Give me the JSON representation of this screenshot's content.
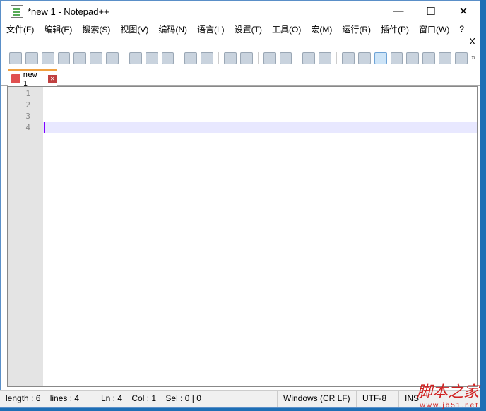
{
  "window": {
    "title": "*new 1 - Notepad++",
    "minimize": "—",
    "maximize": "☐",
    "close": "✕"
  },
  "menu": [
    "文件(F)",
    "编辑(E)",
    "搜索(S)",
    "视图(V)",
    "编码(N)",
    "语言(L)",
    "设置(T)",
    "工具(O)",
    "宏(M)",
    "运行(R)",
    "插件(P)",
    "窗口(W)",
    "?"
  ],
  "close_doc": "X",
  "toolbar_more": "»",
  "tab": {
    "label": "new 1",
    "close": "✕"
  },
  "lines": [
    "1",
    "2",
    "3",
    "4"
  ],
  "status": {
    "length": "length : 6",
    "lines": "lines : 4",
    "ln": "Ln : 4",
    "col": "Col : 1",
    "sel": "Sel : 0 | 0",
    "eol": "Windows (CR LF)",
    "enc": "UTF-8",
    "ins": "INS"
  },
  "watermark": {
    "title": "脚本之家",
    "url": "www.jb51.net"
  }
}
